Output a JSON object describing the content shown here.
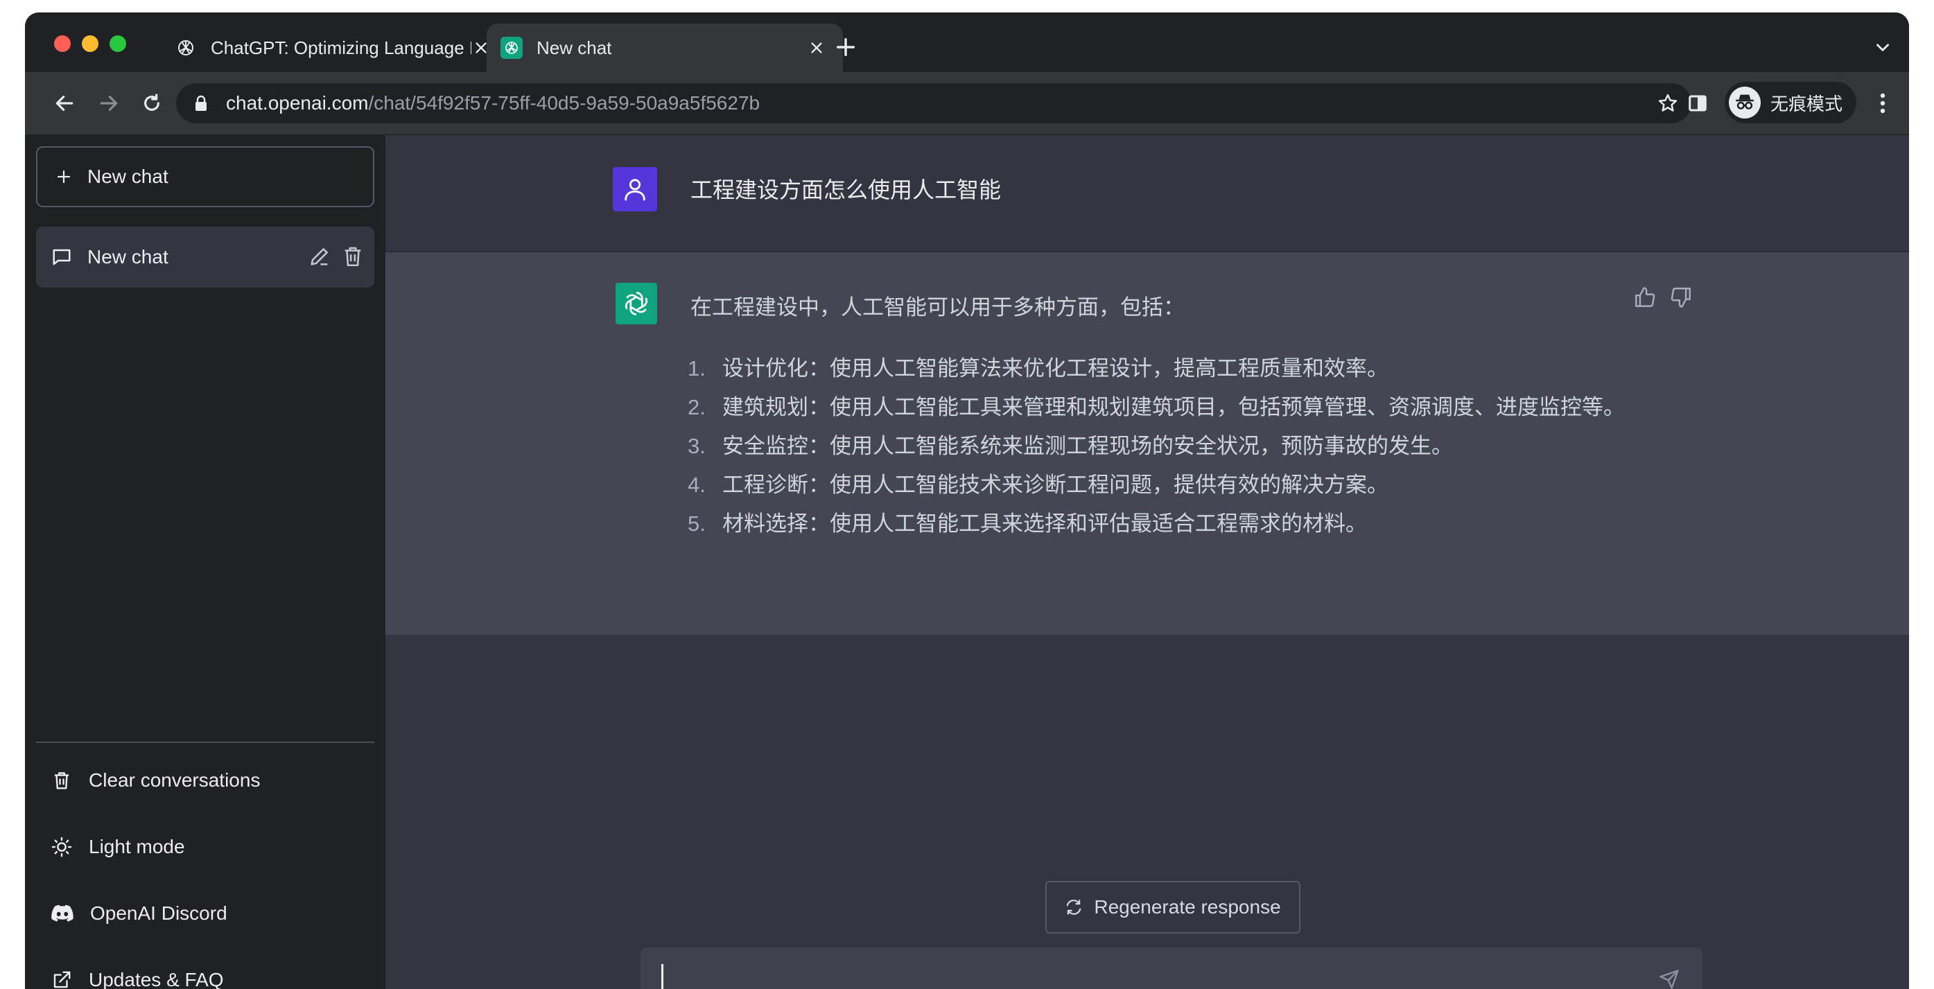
{
  "browser": {
    "tabs": [
      {
        "title": "ChatGPT: Optimizing Language Models for Dialogue",
        "active": false,
        "icon": "openai-icon"
      },
      {
        "title": "New chat",
        "active": true,
        "icon": "openai-icon"
      }
    ],
    "address": {
      "host": "chat.openai.com",
      "path": "/chat/54f92f57-75ff-40d5-9a59-50a9a5f5627b"
    },
    "profile_label": "无痕模式"
  },
  "sidebar": {
    "new_chat_label": "New chat",
    "chats": [
      {
        "title": "New chat"
      }
    ],
    "links": [
      {
        "label": "Clear conversations",
        "icon": "trash-icon"
      },
      {
        "label": "Light mode",
        "icon": "sun-icon"
      },
      {
        "label": "OpenAI Discord",
        "icon": "discord-icon"
      },
      {
        "label": "Updates & FAQ",
        "icon": "external-link-icon"
      }
    ]
  },
  "conversation": {
    "user_message": "工程建设方面怎么使用人工智能",
    "assistant_intro": "在工程建设中，人工智能可以用于多种方面，包括：",
    "assistant_list": [
      {
        "num": "1.",
        "text": "设计优化：使用人工智能算法来优化工程设计，提高工程质量和效率。"
      },
      {
        "num": "2.",
        "text": "建筑规划：使用人工智能工具来管理和规划建筑项目，包括预算管理、资源调度、进度监控等。"
      },
      {
        "num": "3.",
        "text": "安全监控：使用人工智能系统来监测工程现场的安全状况，预防事故的发生。"
      },
      {
        "num": "4.",
        "text": "工程诊断：使用人工智能技术来诊断工程问题，提供有效的解决方案。"
      },
      {
        "num": "5.",
        "text": "材料选择：使用人工智能工具来选择和评估最适合工程需求的材料。"
      }
    ]
  },
  "composer": {
    "regenerate_label": "Regenerate response",
    "input_value": ""
  },
  "colors": {
    "sidebar_bg": "#202123",
    "main_bg": "#343541",
    "assistant_bg": "#444654",
    "user_avatar": "#5436da",
    "bot_avatar": "#10a37f"
  }
}
